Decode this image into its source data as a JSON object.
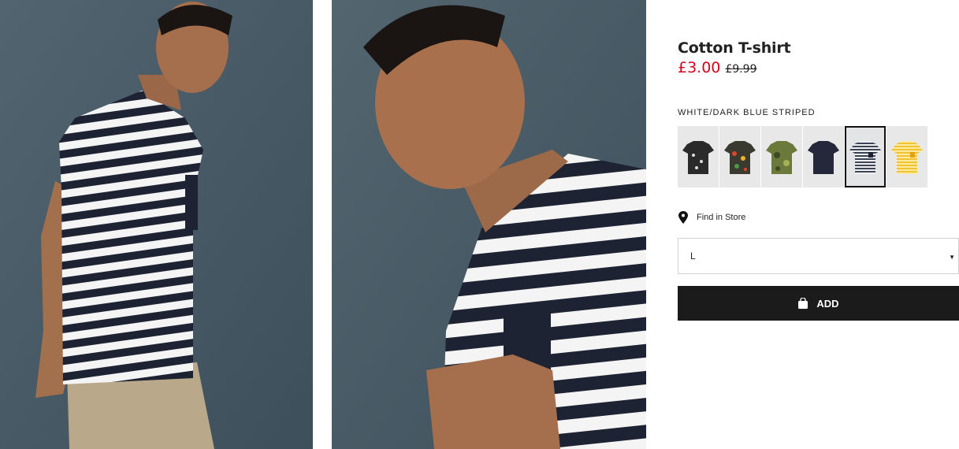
{
  "product": {
    "title": "Cotton T-shirt",
    "price": "£3.00",
    "original_price": "£9.99",
    "color_label": "WHITE/DARK BLUE STRIPED"
  },
  "swatches": [
    {
      "icon": "black-floral-tshirt",
      "color": "#2a2a2a",
      "selected": false
    },
    {
      "icon": "tropical-print-tshirt",
      "color": "#3b3a30",
      "selected": false
    },
    {
      "icon": "green-camo-tshirt",
      "color": "#6b7a3a",
      "selected": false
    },
    {
      "icon": "dark-blue-tshirt",
      "color": "#24283a",
      "selected": false
    },
    {
      "icon": "striped-tshirt",
      "color": "#3a4456",
      "selected": true
    },
    {
      "icon": "yellow-striped-tshirt",
      "color": "#f0c430",
      "selected": false
    }
  ],
  "store": {
    "label": "Find in Store"
  },
  "size": {
    "value": "L"
  },
  "cart": {
    "add_label": "ADD"
  },
  "colors": {
    "sale": "#d6001c",
    "button": "#1b1b1b",
    "backdrop": "#4a5d6b"
  }
}
